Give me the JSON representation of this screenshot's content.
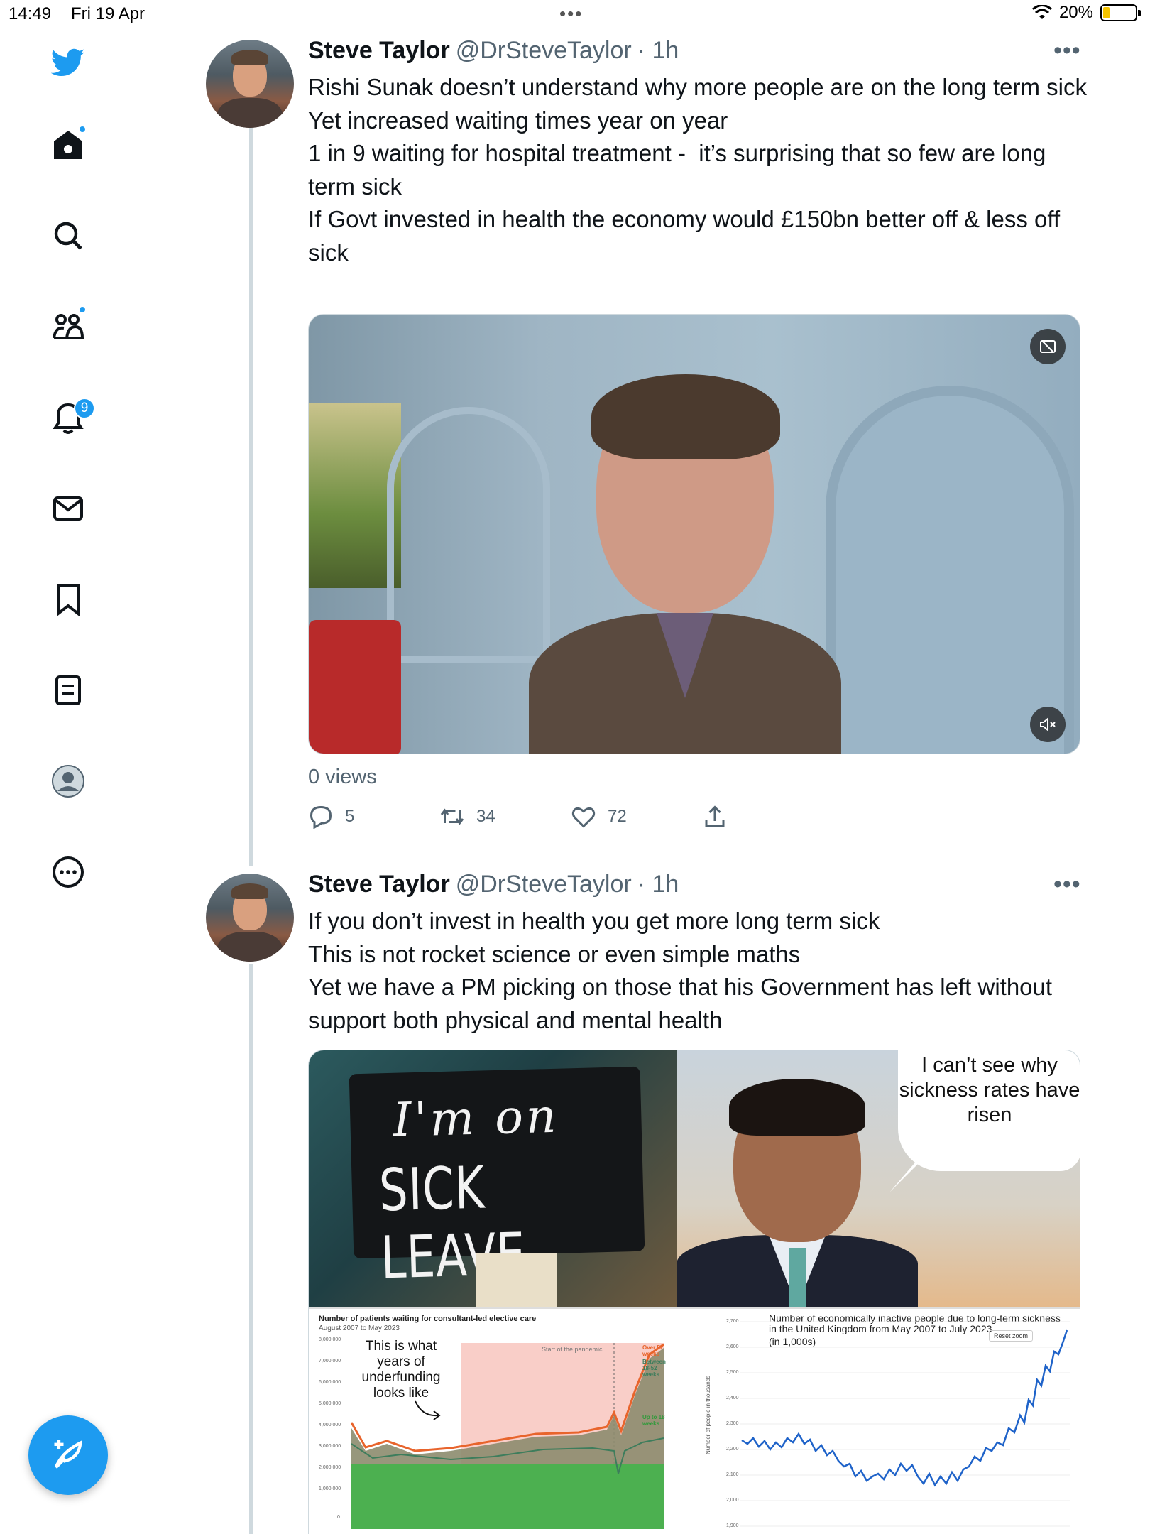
{
  "status": {
    "time": "14:49",
    "date": "Fri 19 Apr",
    "battery": "20%"
  },
  "sidebar": {
    "items": [
      {
        "name": "twitter-logo-icon"
      },
      {
        "name": "home-icon"
      },
      {
        "name": "search-icon"
      },
      {
        "name": "communities-icon"
      },
      {
        "name": "notifications-icon",
        "badge": "9"
      },
      {
        "name": "messages-icon"
      },
      {
        "name": "bookmarks-icon"
      },
      {
        "name": "lists-icon"
      },
      {
        "name": "profile-icon"
      },
      {
        "name": "more-icon"
      }
    ]
  },
  "tweets": [
    {
      "name": "Steve Taylor",
      "handle": "@DrSteveTaylor",
      "time": "· 1h",
      "text": "Rishi Sunak doesn’t understand why more people are on the long term sick\nYet increased waiting times year on year\n1 in 9 waiting for hospital treatment -  it’s surprising that so few are long term sick\nIf Govt invested in health the economy would £150bn better off & less off sick",
      "views": "0 views",
      "replies": "5",
      "retweets": "34",
      "likes": "72"
    },
    {
      "name": "Steve Taylor",
      "handle": "@DrSteveTaylor",
      "time": "· 1h",
      "text": "If you don’t invest in health you get more long term sick\nThis is not rocket science or even simple maths\nYet we have a PM picking on those that his Government has left without support both physical and mental health",
      "image": {
        "board_line1": "I'm   on",
        "board_line2": "SICK LEAVE",
        "bubble": "I can’t see why sickness rates have risen",
        "chart1_title": "Number of patients waiting for consultant-led elective care",
        "chart1_subtitle": "August 2007 to May 2023",
        "chart1_note": "This is what years of underfunding looks like",
        "chart1_band": "Start of the pandemic",
        "chart1_leg1": "Over 52 weeks",
        "chart1_leg2": "Between 18-52 weeks",
        "chart1_leg3": "Up to 18 weeks",
        "chart2_title": "Number of economically inactive people due to long-term sickness in the United Kingdom from May 2007 to July 2023",
        "chart2_units": "(in 1,000s)",
        "chart2_reset": "Reset zoom",
        "chart2_ylabel": "Number of people in thousands"
      }
    }
  ],
  "colors": {
    "accent": "#1d9bf0",
    "text": "#0f1419",
    "muted": "#536471"
  }
}
